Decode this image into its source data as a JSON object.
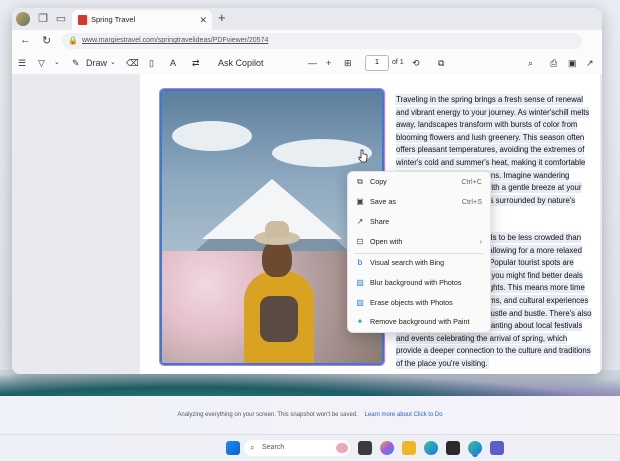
{
  "browser": {
    "tab_title": "Spring Travel",
    "tab_close": "✕",
    "new_tab": "+",
    "url": "www.margiestravel.com/springtravelideas/PDFviewer/20574",
    "window_controls": {
      "minimize": "—",
      "maximize": "▢",
      "close": "✕"
    }
  },
  "toolbar": {
    "draw_label": "Draw",
    "ask_copilot_label": "Ask Copilot",
    "zoom_out": "—",
    "zoom_in": "+",
    "page_number": "1",
    "page_total": "of 1"
  },
  "document": {
    "para1": "Traveling in the spring brings a fresh sense of renewal and vibrant energy to your journey. As winter'schill melts away, landscapes transform with bursts of color from blooming flowers and lush greenery. This season often offers pleasant temperatures, avoiding the extremes of winter's cold and summer's heat, making it comfortable for exploring new destinations. Imagine wandering through cherry blossoms, with a gentle breeze at your back, or hiking through trails surrounded by nature's rebirth.",
    "para2": "Moreover, spring travel tends to be less crowded than the peak summer months, allowing for a more relaxed and enjoyable experience. Popular tourist spots are often more accessible, and you might find better deals on accommodations and flights. This means more time to enjoy attractions, museums, and cultural experiences without the overwhelming hustle and bustle. There's also something particularly enchanting about local festivals and events celebrating the arrival of spring, which provide a deeper connection to the culture and traditions of the place you're visiting."
  },
  "context_menu": {
    "copy": {
      "label": "Copy",
      "shortcut": "Ctrl+C"
    },
    "save_as": {
      "label": "Save as",
      "shortcut": "Ctrl+S"
    },
    "share": {
      "label": "Share"
    },
    "open_with": {
      "label": "Open with"
    },
    "visual_search": {
      "label": "Visual search with Bing"
    },
    "blur_bg": {
      "label": "Blur background with Photos"
    },
    "erase": {
      "label": "Erase objects with Photos"
    },
    "remove_bg": {
      "label": "Remove background with Paint"
    }
  },
  "infobar": {
    "message": "Analyzing everything on your screen. This snapshot won't be saved.",
    "link": "Learn more about Click to Do"
  },
  "taskbar": {
    "search_placeholder": "Search"
  },
  "colors": {
    "accent": "#3a7bd5",
    "highlight": "#e8ecf5"
  }
}
